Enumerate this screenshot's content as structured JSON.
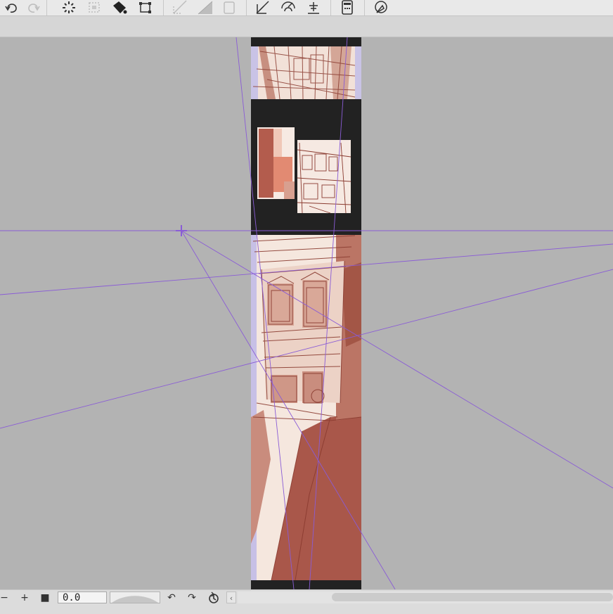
{
  "toolbar": {
    "tools": [
      {
        "name": "undo",
        "icon": "undo-icon",
        "enabled": true
      },
      {
        "name": "redo",
        "icon": "redo-icon",
        "enabled": false
      },
      {
        "name": "loading",
        "icon": "spinner-icon",
        "enabled": true
      },
      {
        "name": "transform",
        "icon": "transform-icon",
        "enabled": false
      },
      {
        "name": "fill",
        "icon": "fill-icon",
        "enabled": true
      },
      {
        "name": "crop",
        "icon": "crop-icon",
        "enabled": true
      },
      {
        "name": "ruler",
        "icon": "ruler-icon",
        "enabled": false
      },
      {
        "name": "gradient",
        "icon": "gradient-icon",
        "enabled": false
      },
      {
        "name": "frame",
        "icon": "frame-icon",
        "enabled": false
      },
      {
        "name": "perspective-ruler",
        "icon": "perspective-icon",
        "enabled": true
      },
      {
        "name": "symmetry",
        "icon": "symmetry-icon",
        "enabled": true
      },
      {
        "name": "concentric",
        "icon": "concentric-icon",
        "enabled": true
      },
      {
        "name": "tablet",
        "icon": "tablet-icon",
        "enabled": true
      },
      {
        "name": "timelapse",
        "icon": "timelapse-icon",
        "enabled": true
      }
    ]
  },
  "statusbar": {
    "zoom_out": "−",
    "zoom_in": "+",
    "stop": "■",
    "zoom_value": "0.0",
    "rotate_left": "↶",
    "rotate_right": "↷",
    "scroll_left": "‹"
  },
  "colors": {
    "canvas_bg": "#b3b3b3",
    "frame_border": "#222222",
    "guide_line": "#8a5cd6",
    "sketch_fill": "#a9574a",
    "sketch_paper": "#f5e7de"
  }
}
